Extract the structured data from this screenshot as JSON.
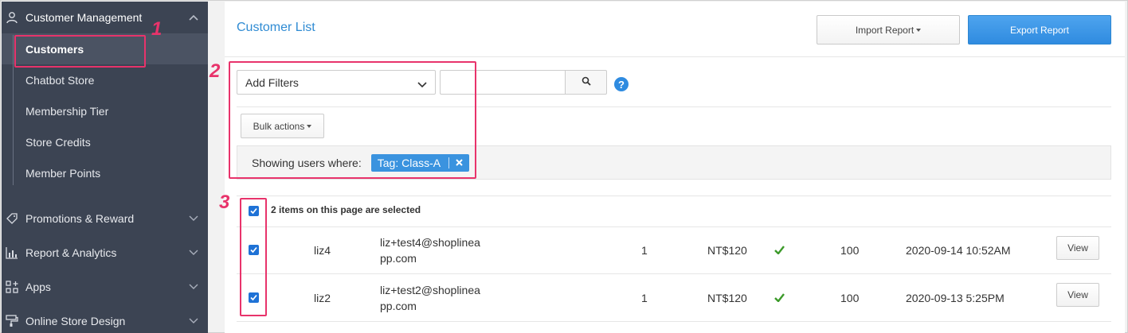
{
  "sidebar": {
    "group_main": "Customer Management",
    "items": [
      {
        "label": "Customers"
      },
      {
        "label": "Chatbot Store"
      },
      {
        "label": "Membership Tier"
      },
      {
        "label": "Store Credits"
      },
      {
        "label": "Member Points"
      }
    ],
    "lower_groups": [
      {
        "label": "Promotions & Reward"
      },
      {
        "label": "Report & Analytics"
      },
      {
        "label": "Apps"
      },
      {
        "label": "Online Store Design"
      }
    ]
  },
  "header": {
    "title": "Customer List",
    "import_label": "Import Report",
    "export_label": "Export Report"
  },
  "filters": {
    "select_value": "Add Filters",
    "search_value": "",
    "bulk_label": "Bulk actions",
    "showing_label": "Showing users where:",
    "tag_label": "Tag: Class-A",
    "help_glyph": "?"
  },
  "selection": {
    "label": "2 items on this page are selected"
  },
  "rows": [
    {
      "name": "liz4",
      "email_line1": "liz+test4@shoplinea",
      "email_line2": "pp.com",
      "orders": "1",
      "amount": "NT$120",
      "points": "100",
      "date": "2020-09-14 10:52AM",
      "view": "View"
    },
    {
      "name": "liz2",
      "email_line1": "liz+test2@shoplinea",
      "email_line2": "pp.com",
      "orders": "1",
      "amount": "NT$120",
      "points": "100",
      "date": "2020-09-13 5:25PM",
      "view": "View"
    }
  ],
  "annotations": [
    "1",
    "2",
    "3"
  ],
  "colors": {
    "accent": "#2f8be0",
    "annotation": "#e8336b",
    "sidebar": "#3c4453",
    "success": "#3c9a2a"
  }
}
